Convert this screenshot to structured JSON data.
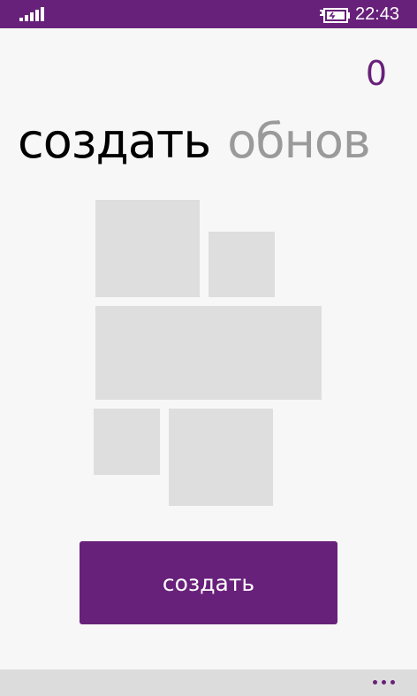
{
  "status_bar": {
    "signal_icon": "signal-strength-icon",
    "battery_icon": "battery-charging-icon",
    "time": "22:43"
  },
  "counter": {
    "value": "0"
  },
  "pivot": {
    "tabs": [
      {
        "label": "создать",
        "active": true
      },
      {
        "label": "обнов",
        "active": false
      }
    ]
  },
  "main": {
    "create_button_label": "создать"
  },
  "app_bar": {
    "more_icon": "more-ellipsis-icon"
  },
  "colors": {
    "accent": "#68217a",
    "tile": "#dedede",
    "background": "#f7f7f7",
    "app_bar": "#dcdcdc"
  }
}
